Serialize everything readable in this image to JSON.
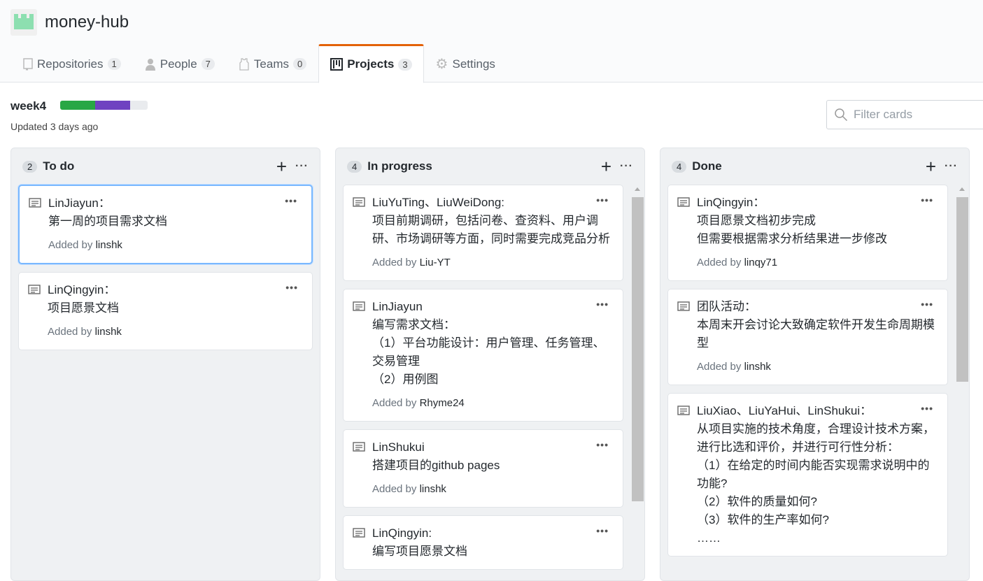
{
  "org": {
    "name": "money-hub"
  },
  "tabs": [
    {
      "label": "Repositories",
      "count": "1",
      "icon": "repo-icon"
    },
    {
      "label": "People",
      "count": "7",
      "icon": "person-icon"
    },
    {
      "label": "Teams",
      "count": "0",
      "icon": "jersey-icon"
    },
    {
      "label": "Projects",
      "count": "3",
      "icon": "project-icon",
      "selected": true
    },
    {
      "label": "Settings",
      "icon": "gear-icon"
    }
  ],
  "project": {
    "title": "week4",
    "updated": "Updated 3 days ago",
    "progress": {
      "done_pct": 40,
      "in_progress_pct": 40,
      "todo_pct": 20,
      "colors": {
        "done": "#28a745",
        "in_progress": "#6f42c1",
        "todo": "#e9ebee"
      }
    }
  },
  "filter": {
    "placeholder": "Filter cards"
  },
  "columns": [
    {
      "title": "To do",
      "count": "2",
      "cards": [
        {
          "lines": [
            "LinJiayun：",
            "第一周的项目需求文档"
          ],
          "added_prefix": "Added by ",
          "author": "linshk"
        },
        {
          "lines": [
            "LinQingyin：",
            "项目愿景文档"
          ],
          "added_prefix": "Added by ",
          "author": "linshk"
        }
      ]
    },
    {
      "title": "In progress",
      "count": "4",
      "cards": [
        {
          "lines": [
            "LiuYuTing、LiuWeiDong:",
            "项目前期调研，包括问卷、查资料、用户调研、市场调研等方面，同时需要完成竞品分析"
          ],
          "added_prefix": "Added by ",
          "author": "Liu-YT"
        },
        {
          "lines": [
            "LinJiayun",
            "编写需求文档：",
            "（1）平台功能设计：用户管理、任务管理、交易管理",
            "（2）用例图"
          ],
          "added_prefix": "Added by ",
          "author": "Rhyme24"
        },
        {
          "lines": [
            "LinShukui",
            "搭建项目的github pages"
          ],
          "added_prefix": "Added by ",
          "author": "linshk"
        },
        {
          "lines": [
            "LinQingyin:",
            "编写项目愿景文档"
          ]
        }
      ]
    },
    {
      "title": "Done",
      "count": "4",
      "cards": [
        {
          "lines": [
            "LinQingyin：",
            "项目愿景文档初步完成",
            "但需要根据需求分析结果进一步修改"
          ],
          "added_prefix": "Added by ",
          "author": "linqy71"
        },
        {
          "lines": [
            "团队活动：",
            "本周末开会讨论大致确定软件开发生命周期模型"
          ],
          "added_prefix": "Added by ",
          "author": "linshk"
        },
        {
          "lines": [
            "LiuXiao、LiuYaHui、LinShukui：",
            "从项目实施的技术角度，合理设计技术方案，进行比选和评价，并进行可行性分析：",
            "（1）在给定的时间内能否实现需求说明中的功能?",
            "（2）软件的质量如何?",
            "（3）软件的生产率如何?",
            "……"
          ]
        }
      ]
    }
  ]
}
